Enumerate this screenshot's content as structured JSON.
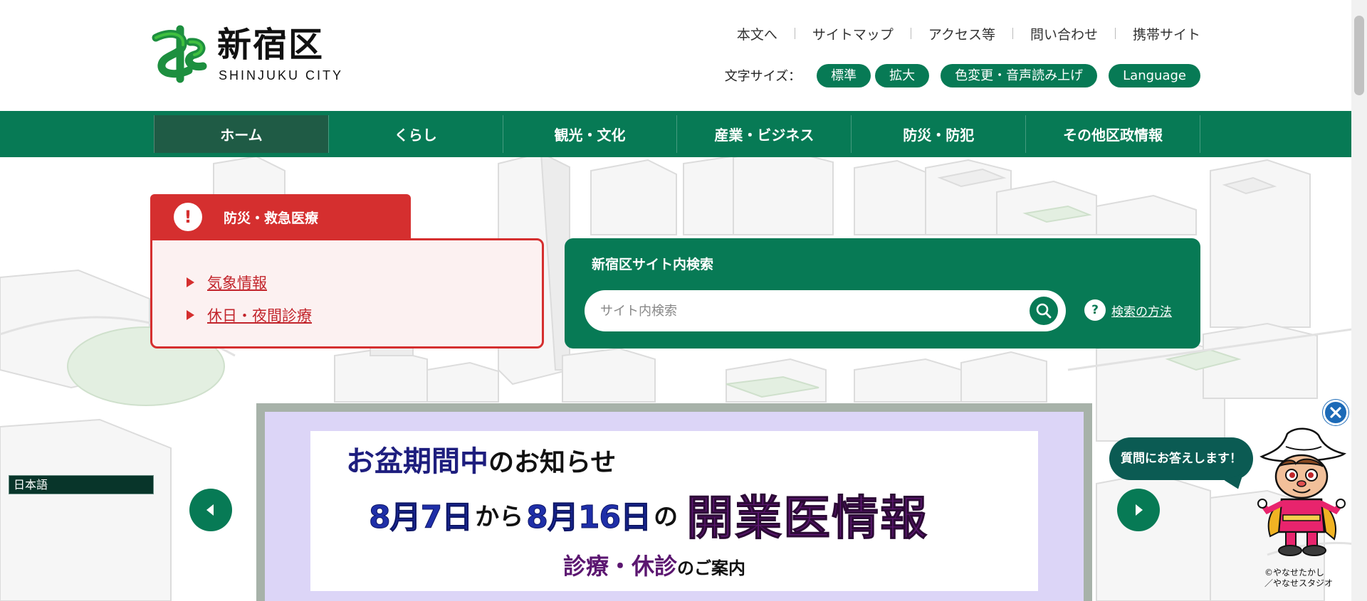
{
  "header": {
    "logo_name": "新宿区",
    "logo_sub": "SHINJUKU CITY",
    "util_links": [
      "本文へ",
      "サイトマップ",
      "アクセス等",
      "問い合わせ",
      "携帯サイト"
    ],
    "font_size_label": "文字サイズ：",
    "font_buttons": [
      "標準",
      "拡大"
    ],
    "color_button": "色変更・音声読み上げ",
    "language_button": "Language"
  },
  "gnav": {
    "items": [
      "ホーム",
      "くらし",
      "観光・文化",
      "産業・ビジネス",
      "防災・防犯",
      "その他区政情報"
    ],
    "active_index": 0
  },
  "emergency": {
    "icon": "!",
    "title": "防災・救急医療",
    "links": [
      "気象情報",
      "休日・夜間診療"
    ]
  },
  "search": {
    "title": "新宿区サイト内検索",
    "placeholder": "サイト内検索",
    "help_icon": "?",
    "help_link": "検索の方法"
  },
  "language_select": "日本語",
  "banner": {
    "line1_a": "お盆期間中",
    "line1_b": "のお知らせ",
    "date_from": "8月7日",
    "kara": "から",
    "date_to": "8月16日",
    "no": "の",
    "big": "開業医情報",
    "line3_a": "診療・休診",
    "line3_b": "のご案内"
  },
  "chatbot": {
    "bubble": "質問にお答えします！",
    "credit_1": "©やなせたかし",
    "credit_2": "／やなせスタジオ"
  },
  "colors": {
    "brand_green": "#077a55",
    "nav_active": "#1f5b45",
    "emergency_red": "#d52f2f",
    "chatbot_teal": "#0b5b53"
  },
  "icons": {
    "search_button": "search-icon",
    "prev": "chevron-left-icon",
    "next": "chevron-right-icon",
    "close": "close-icon"
  }
}
